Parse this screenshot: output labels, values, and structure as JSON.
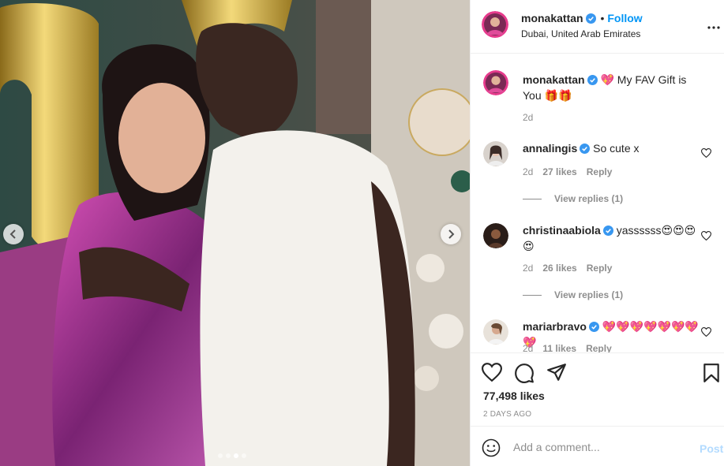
{
  "post": {
    "author": "monakattan",
    "follow_label": "Follow",
    "bullet": "•",
    "location": "Dubai, United Arab Emirates"
  },
  "caption": {
    "username": "monakattan",
    "text": "💖 My FAV Gift is You 🎁🎁",
    "time": "2d"
  },
  "comments": [
    {
      "username": "annalingis",
      "text": "So cute x",
      "time": "2d",
      "likes": "27 likes",
      "reply": "Reply",
      "view_replies": "View replies (1)"
    },
    {
      "username": "christinaabiola",
      "text": "yassssss😍😍😍😍",
      "time": "2d",
      "likes": "26 likes",
      "reply": "Reply",
      "view_replies": "View replies (1)"
    },
    {
      "username": "mariarbravo",
      "text": "💖💖💖💖💖💖💖💖",
      "time": "2d",
      "likes": "11 likes",
      "reply": "Reply"
    }
  ],
  "stats": {
    "likes": "77,498 likes",
    "posted": "2 DAYS AGO"
  },
  "add_comment": {
    "placeholder": "Add a comment...",
    "post_label": "Post"
  },
  "carousel": {
    "slide_count": 4,
    "active_slide": 3
  },
  "colors": {
    "accent": "#0095f6",
    "post_disabled": "#b3dbff",
    "muted": "#8e8e8e"
  }
}
